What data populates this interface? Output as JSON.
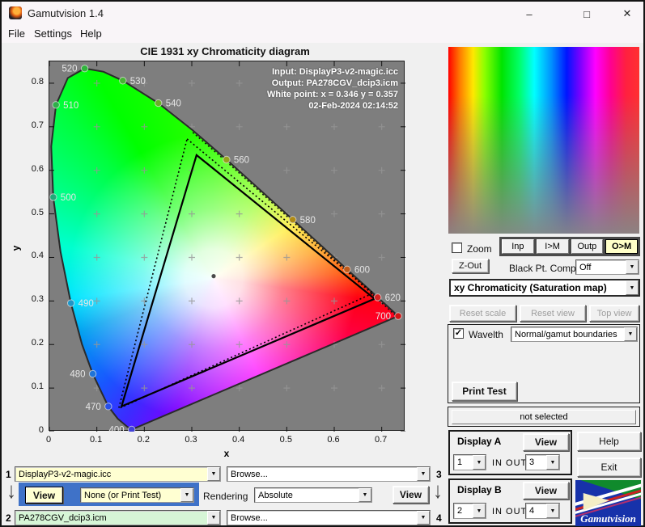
{
  "window": {
    "title": "Gamutvision 1.4",
    "menu": [
      "File",
      "Settings",
      "Help"
    ]
  },
  "chart": {
    "title": "CIE 1931 xy Chromaticity diagram",
    "xlabel": "x",
    "ylabel": "y",
    "annotation": [
      "Input:  DisplayP3-v2-magic.icc",
      "Output: PA278CGV_dcip3.icm",
      "White point:  x = 0.346  y = 0.357",
      "02-Feb-2024 02:14:52"
    ]
  },
  "chart_data": {
    "type": "scatter",
    "title": "CIE 1931 xy Chromaticity diagram",
    "xlabel": "x",
    "ylabel": "y",
    "xlim": [
      0,
      0.75
    ],
    "ylim": [
      0,
      0.85
    ],
    "x_ticks": [
      "0",
      "0.1",
      "0.2",
      "0.3",
      "0.4",
      "0.5",
      "0.6",
      "0.7"
    ],
    "y_ticks": [
      "0",
      "0.1",
      "0.2",
      "0.3",
      "0.4",
      "0.5",
      "0.6",
      "0.7",
      "0.8"
    ],
    "white_point": {
      "x": 0.346,
      "y": 0.357
    },
    "spectral_locus": [
      [
        0.1741,
        0.005
      ],
      [
        0.1644,
        0.0109
      ],
      [
        0.144,
        0.0297
      ],
      [
        0.1241,
        0.0578
      ],
      [
        0.0913,
        0.1327
      ],
      [
        0.0687,
        0.2007
      ],
      [
        0.0454,
        0.295
      ],
      [
        0.0235,
        0.4127
      ],
      [
        0.0082,
        0.5384
      ],
      [
        0.0039,
        0.6548
      ],
      [
        0.0139,
        0.7502
      ],
      [
        0.0389,
        0.812
      ],
      [
        0.0743,
        0.8338
      ],
      [
        0.1142,
        0.8262
      ],
      [
        0.1547,
        0.8059
      ],
      [
        0.2296,
        0.7543
      ],
      [
        0.3016,
        0.6923
      ],
      [
        0.3731,
        0.6245
      ],
      [
        0.4441,
        0.5547
      ],
      [
        0.5125,
        0.4866
      ],
      [
        0.5752,
        0.4242
      ],
      [
        0.627,
        0.3725
      ],
      [
        0.6658,
        0.334
      ],
      [
        0.6915,
        0.3083
      ],
      [
        0.719,
        0.2809
      ],
      [
        0.7347,
        0.2653
      ]
    ],
    "locus_inner_dashed": [
      [
        0.302,
        0.687
      ],
      [
        0.373,
        0.62
      ],
      [
        0.4425,
        0.5518
      ],
      [
        0.51,
        0.4847
      ],
      [
        0.5718,
        0.4232
      ],
      [
        0.6228,
        0.3723
      ],
      [
        0.661,
        0.3343
      ],
      [
        0.6864,
        0.309
      ],
      [
        0.729,
        0.2666
      ]
    ],
    "wavelength_markers": [
      {
        "wl": "400",
        "x": 0.1733,
        "y": 0.0048,
        "side": "left",
        "color": "#4040d8"
      },
      {
        "wl": "470",
        "x": 0.1241,
        "y": 0.0578,
        "side": "left",
        "color": "#2850e8"
      },
      {
        "wl": "480",
        "x": 0.0913,
        "y": 0.1327,
        "side": "left",
        "color": "#1f74d8"
      },
      {
        "wl": "490",
        "x": 0.0454,
        "y": 0.295,
        "side": "right",
        "color": "#1f96c8"
      },
      {
        "wl": "500",
        "x": 0.0082,
        "y": 0.5384,
        "side": "right",
        "color": "#20a878"
      },
      {
        "wl": "510",
        "x": 0.0139,
        "y": 0.7502,
        "side": "right",
        "color": "#2fae4a"
      },
      {
        "wl": "520",
        "x": 0.0743,
        "y": 0.8338,
        "side": "left",
        "color": "#2fb43c"
      },
      {
        "wl": "530",
        "x": 0.1547,
        "y": 0.8059,
        "side": "right",
        "color": "#46b432"
      },
      {
        "wl": "540",
        "x": 0.2296,
        "y": 0.7543,
        "side": "right",
        "color": "#69ae28"
      },
      {
        "wl": "560",
        "x": 0.3731,
        "y": 0.6245,
        "side": "right",
        "color": "#97a01e"
      },
      {
        "wl": "580",
        "x": 0.5125,
        "y": 0.4866,
        "side": "right",
        "color": "#b08a14"
      },
      {
        "wl": "600",
        "x": 0.627,
        "y": 0.3725,
        "side": "right",
        "color": "#c05a1a"
      },
      {
        "wl": "620",
        "x": 0.6915,
        "y": 0.3083,
        "side": "right",
        "color": "#d22222"
      },
      {
        "wl": "700",
        "x": 0.7347,
        "y": 0.2653,
        "side": "left",
        "color": "#d01414"
      }
    ],
    "gamut_triangles": [
      {
        "name": "input gamut (dotted)",
        "style": "dotted",
        "vertices": [
          [
            0.29,
            0.672
          ],
          [
            0.682,
            0.318
          ],
          [
            0.146,
            0.053
          ]
        ]
      },
      {
        "name": "output gamut (solid)",
        "style": "solid",
        "vertices": [
          [
            0.31,
            0.635
          ],
          [
            0.685,
            0.305
          ],
          [
            0.152,
            0.058
          ]
        ]
      }
    ]
  },
  "right_panel": {
    "zoom_label": "Zoom",
    "io_buttons": [
      "Inp",
      "I>M",
      "Outp",
      "O>M"
    ],
    "active_io": "O>M",
    "zout_label": "Z-Out",
    "black_pt_label": "Black Pt. Comp.",
    "black_pt_value": "Off",
    "map_value": "xy Chromaticity (Saturation map)",
    "reset_buttons": [
      "Reset scale",
      "Reset view",
      "Top view"
    ],
    "wavelth_label": "Wavelth",
    "boundaries_value": "Normal/gamut boundaries",
    "print_test_label": "Print Test",
    "status": "not selected",
    "display_a": {
      "title": "Display A",
      "view": "View",
      "in_value": "1",
      "io_label": "IN  OUT",
      "out_value": "3"
    },
    "display_b": {
      "title": "Display B",
      "view": "View",
      "in_value": "2",
      "io_label": "IN  OUT",
      "out_value": "4"
    },
    "help_label": "Help",
    "exit_label": "Exit",
    "logo_text": "Gamutvision"
  },
  "bottom_bar": {
    "row1": {
      "index": "1",
      "profile": "DisplayP3-v2-magic.icc",
      "browse": "Browse...",
      "index_right": "3"
    },
    "middle": {
      "view_a": "View",
      "test_pattern": "None (or Print Test)",
      "rendering_label": "Rendering",
      "intent": "Absolute",
      "view_b": "View"
    },
    "row2": {
      "index": "2",
      "profile": "PA278CGV_dcip3.icm",
      "browse": "Browse...",
      "index_right": "4"
    }
  },
  "colors": {
    "accent_blue_panel": "#3f72c8",
    "pale_yellow": "#ffffd2",
    "pale_green": "#d6f5d6",
    "plot_gray": "#7e7e7e",
    "active_button_yellow": "#ffffc8"
  }
}
